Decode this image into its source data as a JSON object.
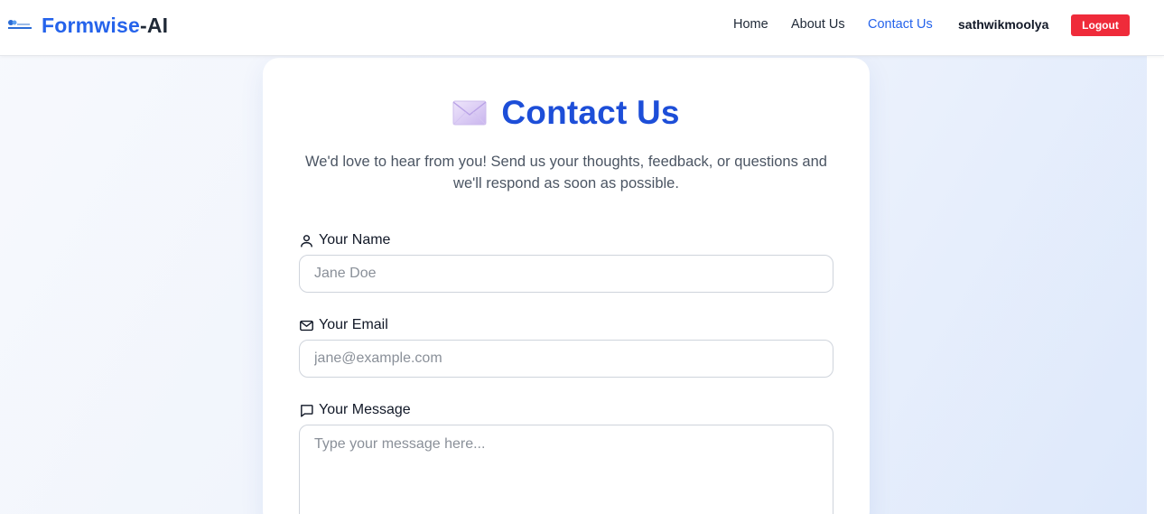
{
  "nav": {
    "brand_part1": "Formwise",
    "brand_part2": "-AI",
    "links": [
      "Home",
      "About Us",
      "Contact Us"
    ],
    "active_link": "Contact Us",
    "username": "sathwikmoolya",
    "logout_label": "Logout"
  },
  "contact": {
    "title": "Contact Us",
    "subtitle": "We'd love to hear from you! Send us your thoughts, feedback, or questions and we'll respond as soon as possible.",
    "name_label": "Your Name",
    "name_placeholder": "Jane Doe",
    "email_label": "Your Email",
    "email_placeholder": "jane@example.com",
    "message_label": "Your Message",
    "message_placeholder": "Type your message here..."
  },
  "icons": {
    "logo": "formwise-logo-icon",
    "title": "envelope-icon",
    "name": "user-icon",
    "email": "mail-icon",
    "message": "message-icon"
  },
  "colors": {
    "brand": "#2563eb",
    "title": "#1d4ed8",
    "logout": "#ef2b3a"
  }
}
